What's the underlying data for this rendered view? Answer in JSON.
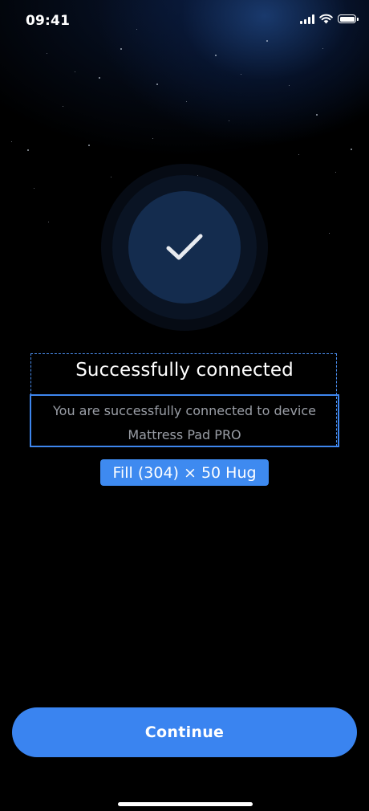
{
  "status_bar": {
    "time": "09:41",
    "icons": [
      "cellular-signal-icon",
      "wifi-icon",
      "battery-icon"
    ]
  },
  "success": {
    "icon": "checkmark-icon",
    "title": "Successfully connected",
    "description_line1": "You are successfully connected to device",
    "description_line2": "Mattress Pad PRO"
  },
  "design_overlay": {
    "size_label": "Fill (304) × 50 Hug"
  },
  "actions": {
    "continue_label": "Continue"
  },
  "colors": {
    "background": "#000000",
    "accent": "#3a84f0",
    "circle_inner": "#142c4e",
    "description_text": "#9a9ea6"
  }
}
